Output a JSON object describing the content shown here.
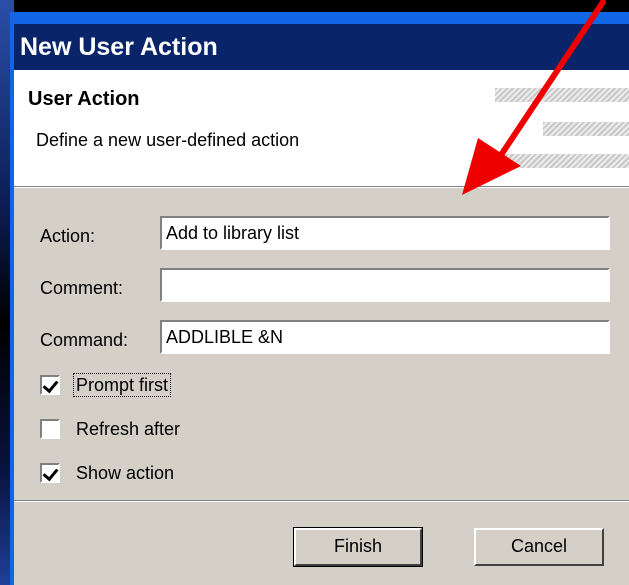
{
  "window": {
    "title": "New User Action"
  },
  "banner": {
    "title": "User Action",
    "description": "Define a new user-defined action"
  },
  "form": {
    "action_label": "Action:",
    "action_value": "Add to library list",
    "comment_label": "Comment:",
    "comment_value": "",
    "command_label": "Command:",
    "command_value": "ADDLIBLE &N"
  },
  "options": [
    {
      "label": "Prompt first",
      "checked": true
    },
    {
      "label": "Refresh after",
      "checked": false
    },
    {
      "label": "Show action",
      "checked": true
    }
  ],
  "buttons": {
    "finish": "Finish",
    "cancel": "Cancel"
  },
  "colors": {
    "arrow": "#ee0000",
    "titlebar": "#0a246a",
    "window_frame": "#1166e8"
  }
}
